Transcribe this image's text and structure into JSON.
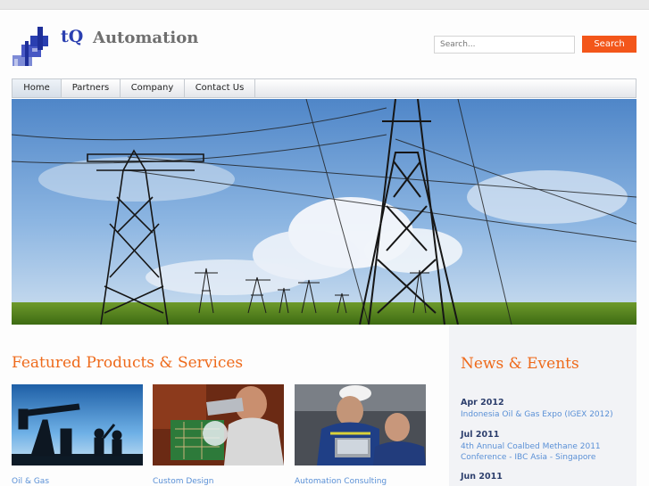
{
  "brand": {
    "name_part1": "tQ",
    "name_part2": "Automation",
    "colors": {
      "accent": "#f3561a",
      "heading": "#ee6a1b",
      "link": "#5a90d6",
      "logo_blue": "#2a3fb0"
    }
  },
  "search": {
    "placeholder": "Search...",
    "button_label": "Search"
  },
  "nav": {
    "items": [
      {
        "label": "Home",
        "active": true
      },
      {
        "label": "Partners",
        "active": false
      },
      {
        "label": "Company",
        "active": false
      },
      {
        "label": "Contact Us",
        "active": false
      }
    ]
  },
  "hero": {
    "image": "power-transmission-towers-photo"
  },
  "featured": {
    "title": "Featured Products & Services",
    "items": [
      {
        "label": "Oil & Gas",
        "image": "oil-pump-silhouette-photo"
      },
      {
        "label": "Custom Design",
        "image": "circuit-board-engineer-photo"
      },
      {
        "label": "Automation Consulting",
        "image": "field-engineers-laptop-photo"
      }
    ]
  },
  "news": {
    "title": "News & Events",
    "items": [
      {
        "date": "Apr 2012",
        "text": "Indonesia Oil & Gas Expo (IGEX 2012)"
      },
      {
        "date": "Jul 2011",
        "text": "4th Annual Coalbed Methane 2011 Conference - IBC Asia - Singapore"
      },
      {
        "date": "Jun 2011",
        "text": ""
      }
    ]
  }
}
